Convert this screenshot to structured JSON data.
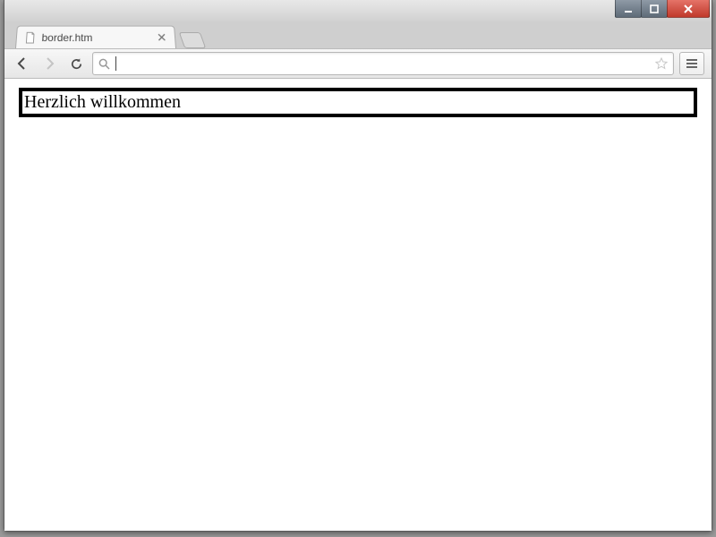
{
  "window": {
    "controls": {
      "minimize": "minimize",
      "maximize": "maximize",
      "close": "close"
    }
  },
  "tabs": [
    {
      "title": "border.htm"
    }
  ],
  "toolbar": {
    "back": "back",
    "forward": "forward",
    "reload": "reload",
    "url_value": "",
    "menu": "menu"
  },
  "page": {
    "heading": "Herzlich willkommen"
  }
}
